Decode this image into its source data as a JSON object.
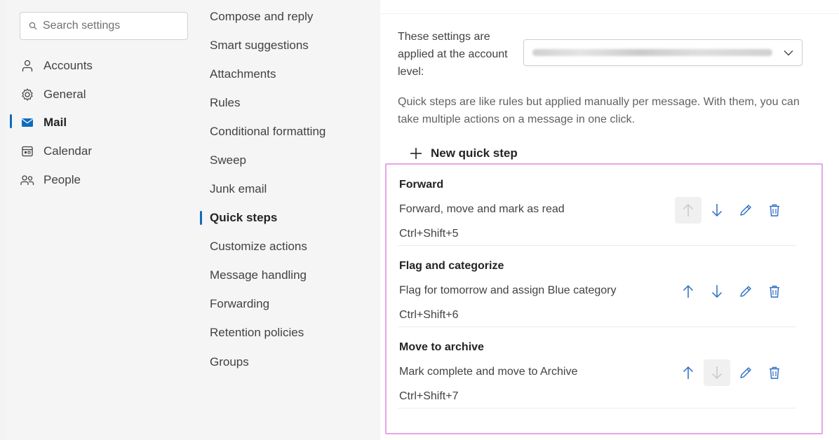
{
  "search": {
    "placeholder": "Search settings"
  },
  "nav": {
    "items": [
      {
        "label": "Accounts",
        "icon": "person-icon"
      },
      {
        "label": "General",
        "icon": "gear-icon"
      },
      {
        "label": "Mail",
        "icon": "mail-icon",
        "selected": true
      },
      {
        "label": "Calendar",
        "icon": "calendar-icon"
      },
      {
        "label": "People",
        "icon": "people-icon"
      }
    ]
  },
  "subnav": {
    "items": [
      {
        "label": "Compose and reply"
      },
      {
        "label": "Smart suggestions"
      },
      {
        "label": "Attachments"
      },
      {
        "label": "Rules"
      },
      {
        "label": "Conditional formatting"
      },
      {
        "label": "Sweep"
      },
      {
        "label": "Junk email"
      },
      {
        "label": "Quick steps",
        "selected": true
      },
      {
        "label": "Customize actions"
      },
      {
        "label": "Message handling"
      },
      {
        "label": "Forwarding"
      },
      {
        "label": "Retention policies"
      },
      {
        "label": "Groups"
      }
    ]
  },
  "content": {
    "account_label": "These settings are applied at the account level:",
    "description": "Quick steps are like rules but applied manually per message. With them, you can take multiple actions on a message in one click.",
    "new_step_label": "New quick step",
    "steps": [
      {
        "title": "Forward",
        "desc": "Forward, move and mark as read",
        "shortcut": "Ctrl+Shift+5",
        "up_disabled": true,
        "down_disabled": false
      },
      {
        "title": "Flag and categorize",
        "desc": "Flag for tomorrow and assign Blue category",
        "shortcut": "Ctrl+Shift+6",
        "up_disabled": false,
        "down_disabled": false
      },
      {
        "title": "Move to archive",
        "desc": "Mark complete and move to Archive",
        "shortcut": "Ctrl+Shift+7",
        "up_disabled": false,
        "down_disabled": true
      }
    ]
  },
  "colors": {
    "accent": "#0f6cbd",
    "highlight_border": "#e8a5e6",
    "icon_blue": "#2b6cc4"
  }
}
